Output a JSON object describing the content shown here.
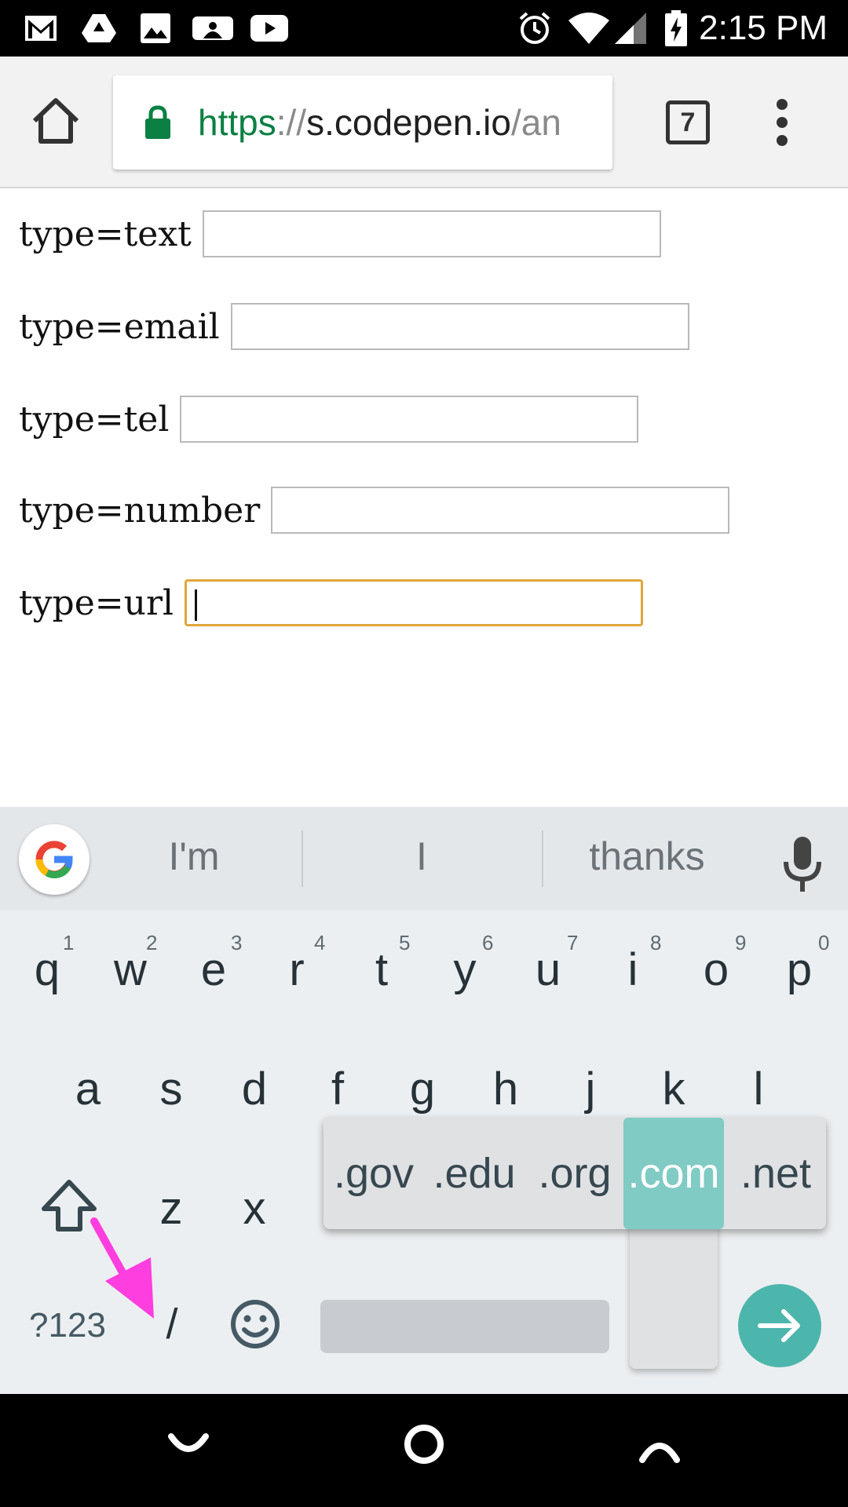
{
  "status_bar": {
    "time": "2:15 PM",
    "left_icons": [
      "gmail-icon",
      "drive-icon",
      "photos-icon",
      "mlb-icon",
      "youtube-icon"
    ],
    "right_icons": [
      "alarm-icon",
      "wifi-icon",
      "signal-icon",
      "battery-charging-icon"
    ]
  },
  "browser": {
    "url_scheme": "https",
    "url_separator": "://",
    "url_host": "s.codepen.io",
    "url_path": "/an",
    "tab_count": "7",
    "secure_color": "#0b8043"
  },
  "form": {
    "fields": [
      {
        "label": "type=text",
        "value": ""
      },
      {
        "label": "type=email",
        "value": ""
      },
      {
        "label": "type=tel",
        "value": ""
      },
      {
        "label": "type=number",
        "value": ""
      },
      {
        "label": "type=url",
        "value": "",
        "focused": true
      }
    ],
    "focus_color": "#e0a63a"
  },
  "keyboard": {
    "suggestions": [
      "I'm",
      "I",
      "thanks"
    ],
    "row1": [
      "q",
      "w",
      "e",
      "r",
      "t",
      "y",
      "u",
      "i",
      "o",
      "p"
    ],
    "row1_hints": [
      "1",
      "2",
      "3",
      "4",
      "5",
      "6",
      "7",
      "8",
      "9",
      "0"
    ],
    "row2": [
      "a",
      "s",
      "d",
      "f",
      "g",
      "h",
      "j",
      "k",
      "l"
    ],
    "row3": [
      "z",
      "x"
    ],
    "symbols_key": "?123",
    "slash_key": "/",
    "domain_popup": [
      ".gov",
      ".edu",
      ".org",
      ".com",
      ".net"
    ],
    "domain_selected": ".com",
    "accent_color": "#4db6ac",
    "annotation_arrow_color": "#ff3ee0"
  }
}
